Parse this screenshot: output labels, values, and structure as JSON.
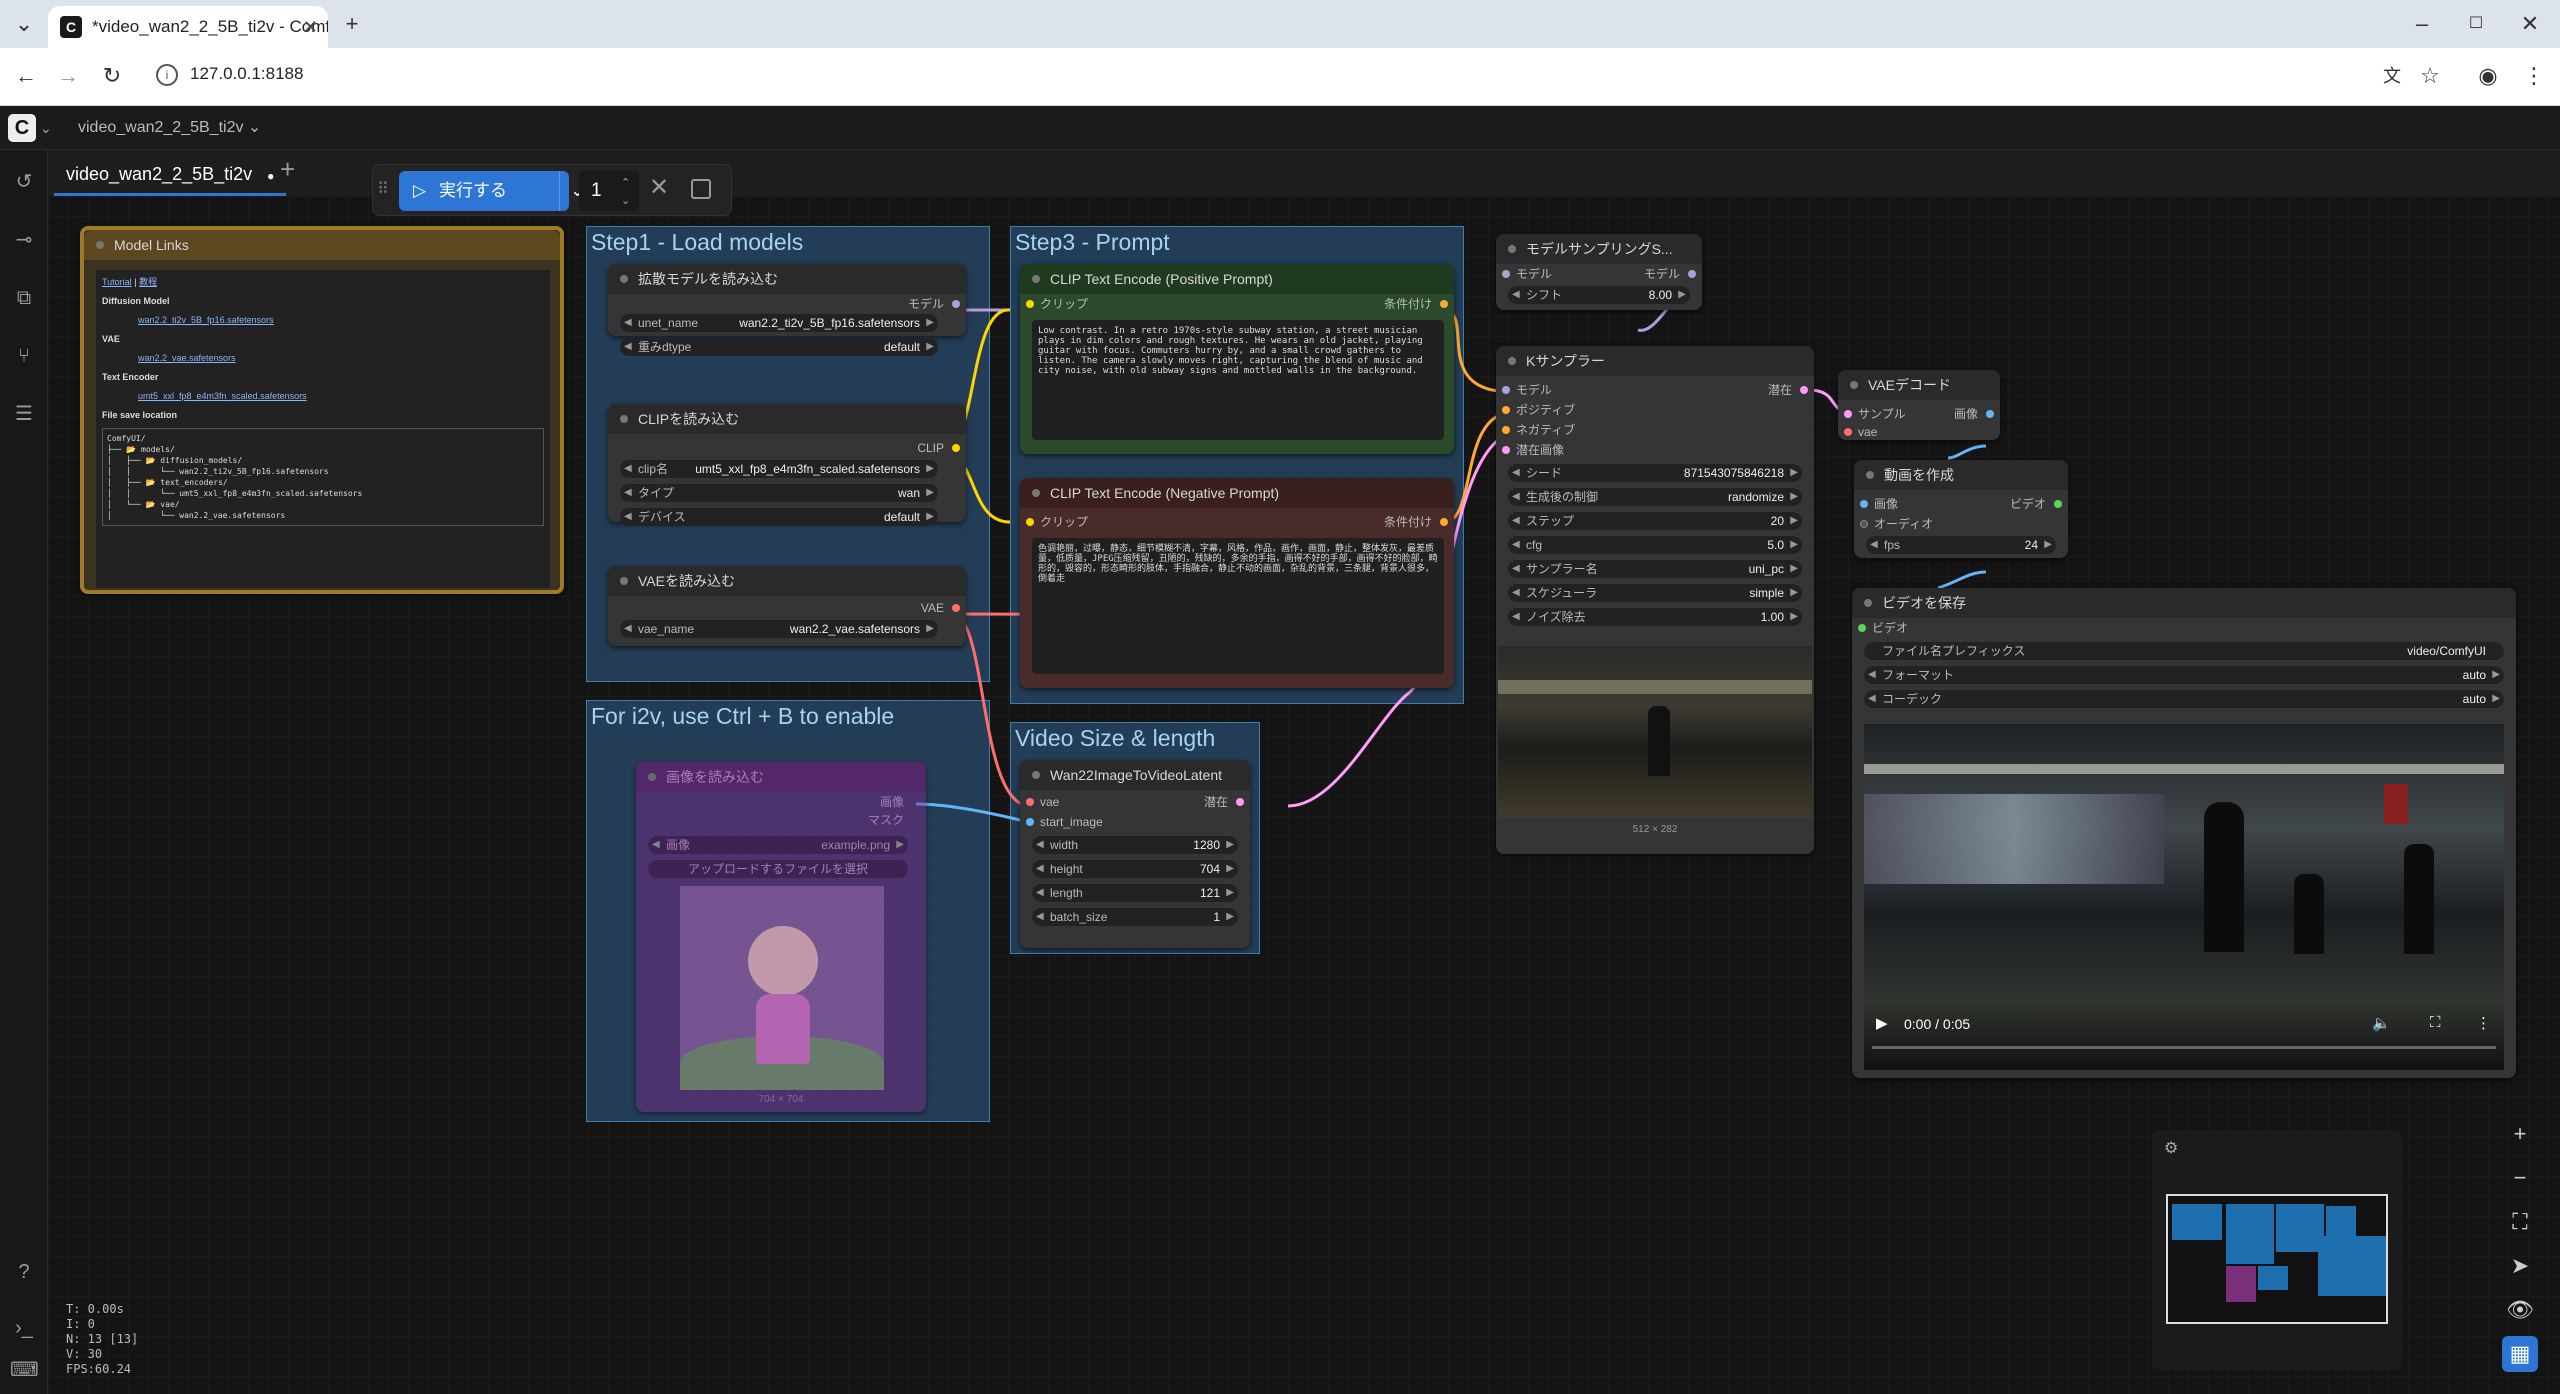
{
  "browser": {
    "tab_title": "*video_wan2_2_5B_ti2v - Comf",
    "tab_close": "✕",
    "new_tab": "+",
    "url": "127.0.0.1:8188",
    "window_controls": [
      "–",
      "☐",
      "✕"
    ]
  },
  "app": {
    "workflow_menu": "video_wan2_2_5B_ti2v ⌄",
    "workflow_tab": "video_wan2_2_5B_ti2v",
    "tab_modified": "●",
    "add_tab": "+"
  },
  "runbar": {
    "run_label": "実行する",
    "run_count": "1"
  },
  "groups": {
    "step1": "Step1 - Load models",
    "step3": "Step3 - Prompt",
    "i2v": "For i2v, use Ctrl + B to enable",
    "video_size": "Video Size & length"
  },
  "model_links": {
    "title": "Model Links",
    "tutorial": "Tutorial",
    "sep": "|",
    "tutorial_jp": "教程",
    "diffusion_heading": "Diffusion Model",
    "diffusion_file": "wan2.2_ti2v_5B_fp16.safetensors",
    "vae_heading": "VAE",
    "vae_file": "wan2.2_vae.safetensors",
    "te_heading": "Text Encoder",
    "te_file": "umt5_xxl_fp8_e4m3fn_scaled.safetensors",
    "save_location": "File save location",
    "tree": [
      "ComfyUI/",
      "├── 📂 models/",
      "│   ├── 📂 diffusion_models/",
      "│   │      └── wan2.2_ti2v_5B_fp16.safetensors",
      "│   ├── 📂 text_encoders/",
      "│   │      └── umt5_xxl_fp8_e4m3fn_scaled.safetensors",
      "│   └── 📂 vae/",
      "│          └── wan2.2_vae.safetensors"
    ]
  },
  "unet_loader": {
    "title": "拡散モデルを読み込む",
    "out": "モデル",
    "unet_name_label": "unet_name",
    "unet_name": "wan2.2_ti2v_5B_fp16.safetensors",
    "dtype_label": "重みdtype",
    "dtype": "default"
  },
  "clip_loader": {
    "title": "CLIPを読み込む",
    "out": "CLIP",
    "clip_name_label": "clip名",
    "clip_name": "umt5_xxl_fp8_e4m3fn_scaled.safetensors",
    "type_label": "タイプ",
    "type": "wan",
    "device_label": "デバイス",
    "device": "default"
  },
  "vae_loader": {
    "title": "VAEを読み込む",
    "out": "VAE",
    "vae_name_label": "vae_name",
    "vae_name": "wan2.2_vae.safetensors"
  },
  "clip_pos": {
    "title": "CLIP Text Encode (Positive Prompt)",
    "in": "クリップ",
    "out": "条件付け",
    "text": "Low contrast. In a retro 1970s-style subway station, a street musician plays in dim colors and rough textures. He wears an old jacket, playing guitar with focus. Commuters hurry by, and a small crowd gathers to listen. The camera slowly moves right, capturing the blend of music and city noise, with old subway signs and mottled walls in the background."
  },
  "clip_neg": {
    "title": "CLIP Text Encode (Negative Prompt)",
    "in": "クリップ",
    "out": "条件付け",
    "text": "色调艳丽，过曝，静态，细节模糊不清，字幕，风格，作品，画作，画面，静止，整体发灰，最差质量，低质量，JPEG压缩残留，丑陋的，残缺的，多余的手指，画得不好的手部，画得不好的脸部，畸形的，毁容的，形态畸形的肢体，手指融合，静止不动的画面，杂乱的背景，三条腿，背景人很多，倒着走"
  },
  "load_image": {
    "title": "画像を読み込む",
    "out1": "画像",
    "out2": "マスク",
    "image_label": "画像",
    "image": "example.png",
    "upload": "アップロードするファイルを選択",
    "caption": "704 × 704"
  },
  "wan_latent": {
    "title": "Wan22ImageToVideoLatent",
    "in_vae": "vae",
    "in_start": "start_image",
    "out": "潜在",
    "width_label": "width",
    "width": "1280",
    "height_label": "height",
    "height": "704",
    "length_label": "length",
    "length": "121",
    "batch_label": "batch_size",
    "batch": "1"
  },
  "model_sampling": {
    "title": "モデルサンプリングS...",
    "in": "モデル",
    "out": "モデル",
    "shift_label": "シフト",
    "shift": "8.00"
  },
  "ksampler": {
    "title": "Kサンプラー",
    "in_model": "モデル",
    "in_pos": "ポジティブ",
    "in_neg": "ネガティブ",
    "in_latent": "潜在画像",
    "out": "潜在",
    "seed_label": "シード",
    "seed": "871543075846218",
    "control_label": "生成後の制御",
    "control": "randomize",
    "steps_label": "ステップ",
    "steps": "20",
    "cfg_label": "cfg",
    "cfg": "5.0",
    "sampler_label": "サンプラー名",
    "sampler": "uni_pc",
    "scheduler_label": "スケジューラ",
    "scheduler": "simple",
    "denoise_label": "ノイズ除去",
    "denoise": "1.00",
    "preview_caption": "512 × 282"
  },
  "vae_decode": {
    "title": "VAEデコード",
    "in_samples": "サンプル",
    "in_vae": "vae",
    "out": "画像"
  },
  "create_video": {
    "title": "動画を作成",
    "in_images": "画像",
    "in_audio": "オーディオ",
    "out": "ビデオ",
    "fps_label": "fps",
    "fps": "24"
  },
  "save_video": {
    "title": "ビデオを保存",
    "in": "ビデオ",
    "prefix_label": "ファイル名プレフィックス",
    "prefix": "video/ComfyUI",
    "format_label": "フォーマット",
    "format": "auto",
    "codec_label": "コーデック",
    "codec": "auto",
    "time": "0:00 / 0:05"
  },
  "stats": {
    "t": "T: 0.00s",
    "i": "I: 0",
    "n": "N: 13 [13]",
    "v": "V: 30",
    "fps": "FPS:60.24"
  },
  "colors": {
    "accent": "#2d76d6",
    "group": "#305f8c",
    "pos_prompt": "#2f6b2f",
    "neg_prompt": "#6b2f2f",
    "model_links": "#a07a2a",
    "load_image": "#7a2f7a"
  }
}
